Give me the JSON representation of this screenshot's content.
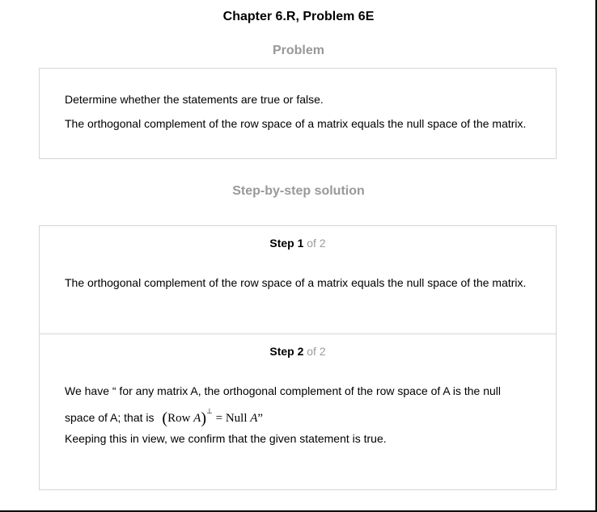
{
  "header": {
    "title": "Chapter 6.R, Problem 6E"
  },
  "problem": {
    "label": "Problem",
    "line1": "Determine whether the statements are true or false.",
    "line2": "The orthogonal complement of the row space of a matrix equals the null space of the matrix."
  },
  "solution": {
    "label": "Step-by-step solution",
    "steps": [
      {
        "step_word": "Step 1",
        "of_text": "of 2",
        "text": "The orthogonal complement of the row space of a matrix equals the null space of the matrix."
      },
      {
        "step_word": "Step 2",
        "of_text": "of 2",
        "text_line1": "We have “ for any matrix A, the orthogonal complement of the row space of A is the null",
        "text_line2": "space of A; that is",
        "math_row": "Row",
        "math_a": "A",
        "math_perp": "⊥",
        "math_eq": "= Null",
        "math_a2": "A",
        "math_close": "”",
        "conclusion": "Keeping this in view, we confirm that the given statement is true."
      }
    ]
  }
}
